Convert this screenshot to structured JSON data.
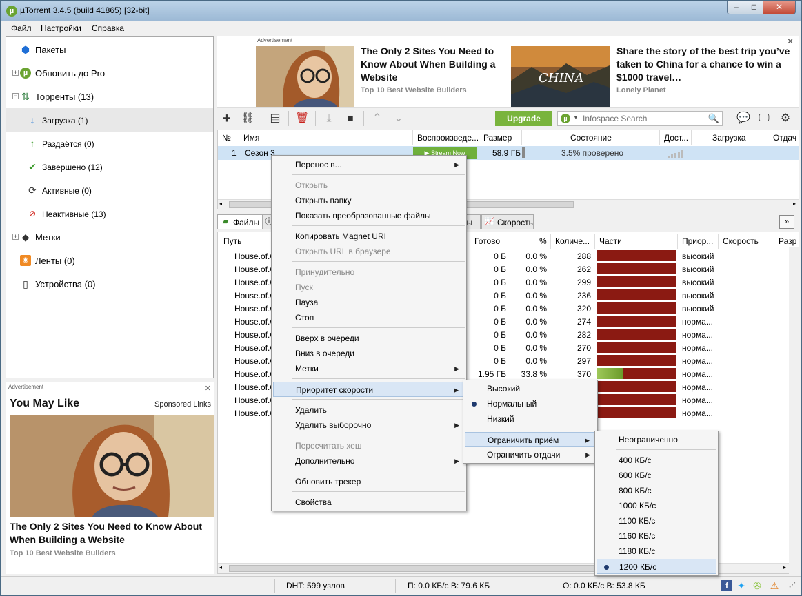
{
  "window": {
    "title": "µTorrent 3.4.5  (build 41865) [32-bit]",
    "logo_glyph": "µ",
    "min_glyph": "–",
    "max_glyph": "□",
    "close_glyph": "✕"
  },
  "menubar": [
    "Файл",
    "Настройки",
    "Справка"
  ],
  "sidebar": {
    "items": [
      {
        "label": "Пакеты",
        "icon": "bundle-icon"
      },
      {
        "label": "Обновить до Pro",
        "icon": "utorrent-icon",
        "expander": "+"
      },
      {
        "label": "Торренты (13)",
        "icon": "torrents-icon",
        "expander": "−"
      },
      {
        "label": "Загрузка (1)",
        "icon": "download-arrow-icon"
      },
      {
        "label": "Раздаётся (0)",
        "icon": "upload-arrow-icon"
      },
      {
        "label": "Завершено (12)",
        "icon": "checkmark-icon"
      },
      {
        "label": "Активные (0)",
        "icon": "refresh-icon"
      },
      {
        "label": "Неактивные (13)",
        "icon": "inactive-icon"
      },
      {
        "label": "Метки",
        "icon": "label-icon",
        "expander": "+"
      },
      {
        "label": "Ленты (0)",
        "icon": "rss-icon"
      },
      {
        "label": "Устройства (0)",
        "icon": "device-icon"
      }
    ]
  },
  "left_ad": {
    "label": "Advertisement",
    "close": "✕",
    "heading": "You May Like",
    "sponsored": "Sponsored Links",
    "headline": "The Only 2 Sites You Need to Know About When Building a Website",
    "source": "Top 10 Best Website Builders"
  },
  "top_ad": {
    "label": "Advertisement",
    "close": "✕",
    "ad1_headline": "The Only 2 Sites You Need to Know About When Building a Website",
    "ad1_source": "Top 10 Best Website Builders",
    "ad2_headline": "Share the story of the best trip you’ve taken to China for a chance to win a $1000 travel…",
    "ad2_source": "Lonely Planet",
    "ad2_image_text": "CHINA"
  },
  "toolbar": {
    "upgrade_label": "Upgrade",
    "search_placeholder": "Infospace Search"
  },
  "torrents": {
    "columns": [
      "№",
      "Имя",
      "Воспроизведе...",
      "Размер",
      "Состояние",
      "Дост...",
      "Загрузка",
      "Отдач"
    ],
    "rows": [
      {
        "num": "1",
        "name": "Сезон 3",
        "stream": "▶ Stream Now",
        "size": "58.9 ГБ",
        "status": "3.5% проверено"
      }
    ]
  },
  "tabs": {
    "files": "Файлы",
    "peers": "ры",
    "speed": "Скорость",
    "collapse": "»"
  },
  "files": {
    "columns": [
      "Путь",
      "Готово",
      "%",
      "Количе...",
      "Части",
      "Приор...",
      "Скорость",
      "Разр"
    ],
    "rows": [
      {
        "path": "House.of.C",
        "done": "0 Б",
        "pct": "0.0 %",
        "count": "288",
        "prio": "высокий",
        "progress": 0
      },
      {
        "path": "House.of.C",
        "done": "0 Б",
        "pct": "0.0 %",
        "count": "262",
        "prio": "высокий",
        "progress": 0
      },
      {
        "path": "House.of.C",
        "done": "0 Б",
        "pct": "0.0 %",
        "count": "299",
        "prio": "высокий",
        "progress": 0
      },
      {
        "path": "House.of.C",
        "done": "0 Б",
        "pct": "0.0 %",
        "count": "236",
        "prio": "высокий",
        "progress": 0
      },
      {
        "path": "House.of.C",
        "done": "0 Б",
        "pct": "0.0 %",
        "count": "320",
        "prio": "высокий",
        "progress": 0
      },
      {
        "path": "House.of.C",
        "done": "0 Б",
        "pct": "0.0 %",
        "count": "274",
        "prio": "норма...",
        "progress": 0
      },
      {
        "path": "House.of.C",
        "done": "0 Б",
        "pct": "0.0 %",
        "count": "282",
        "prio": "норма...",
        "progress": 0
      },
      {
        "path": "House.of.C",
        "done": "0 Б",
        "pct": "0.0 %",
        "count": "270",
        "prio": "норма...",
        "progress": 0
      },
      {
        "path": "House.of.C",
        "done": "0 Б",
        "pct": "0.0 %",
        "count": "297",
        "prio": "норма...",
        "progress": 0
      },
      {
        "path": "House.of.C",
        "done": "1.95 ГБ",
        "pct": "33.8 %",
        "count": "370",
        "prio": "норма...",
        "progress": 0.338
      },
      {
        "path": "House.of.C",
        "done": "",
        "pct": "",
        "count": "",
        "prio": "норма...",
        "progress": 0
      },
      {
        "path": "House.of.C",
        "done": "",
        "pct": "",
        "count": "",
        "prio": "норма...",
        "progress": 0
      },
      {
        "path": "House.of.C",
        "done": "",
        "pct": "",
        "count": "",
        "prio": "норма...",
        "progress": 0
      }
    ]
  },
  "statusbar": {
    "dht": "DHT: 599 узлов",
    "download": "П: 0.0 КБ/с В: 79.6 КБ",
    "upload": "О: 0.0 КБ/с В: 53.8 КБ"
  },
  "context_menu": {
    "items": [
      {
        "label": "Перенос в...",
        "submenu": true
      },
      {
        "sep": true
      },
      {
        "label": "Открыть",
        "disabled": true
      },
      {
        "label": "Открыть папку"
      },
      {
        "label": "Показать преобразованные файлы"
      },
      {
        "sep": true
      },
      {
        "label": "Копировать Magnet URI"
      },
      {
        "label": "Открыть URL в браузере",
        "disabled": true
      },
      {
        "sep": true
      },
      {
        "label": "Принудительно",
        "disabled": true
      },
      {
        "label": "Пуск",
        "disabled": true
      },
      {
        "label": "Пауза"
      },
      {
        "label": "Стоп"
      },
      {
        "sep": true
      },
      {
        "label": "Вверх в очереди"
      },
      {
        "label": "Вниз в очереди"
      },
      {
        "label": "Метки",
        "submenu": true
      },
      {
        "sep": true
      },
      {
        "label": "Приоритет скорости",
        "submenu": true,
        "highlight": true
      },
      {
        "sep": true
      },
      {
        "label": "Удалить"
      },
      {
        "label": "Удалить выборочно",
        "submenu": true
      },
      {
        "sep": true
      },
      {
        "label": "Пересчитать хеш",
        "disabled": true
      },
      {
        "label": "Дополнительно",
        "submenu": true
      },
      {
        "sep": true
      },
      {
        "label": "Обновить трекер"
      },
      {
        "sep": true
      },
      {
        "label": "Свойства"
      }
    ]
  },
  "priority_menu": {
    "items": [
      {
        "label": "Высокий"
      },
      {
        "label": "Нормальный",
        "checked": true
      },
      {
        "label": "Низкий"
      },
      {
        "sep": true
      },
      {
        "label": "Ограничить приём",
        "submenu": true,
        "highlight": true
      },
      {
        "label": "Ограничить отдачи",
        "submenu": true
      }
    ]
  },
  "limit_menu": {
    "items": [
      {
        "label": "Неограниченно"
      },
      {
        "sep": true
      },
      {
        "label": "400 КБ/с"
      },
      {
        "label": "600 КБ/с"
      },
      {
        "label": "800 КБ/с"
      },
      {
        "label": "1000 КБ/с"
      },
      {
        "label": "1100 КБ/с"
      },
      {
        "label": "1160 КБ/с"
      },
      {
        "label": "1180 КБ/с"
      },
      {
        "label": "1200 КБ/с",
        "checked": true,
        "highlight": true
      }
    ]
  },
  "colors": {
    "accent_green": "#79b43d",
    "pieces_red": "#8b1a12",
    "selection_blue": "#cfe3f5"
  }
}
